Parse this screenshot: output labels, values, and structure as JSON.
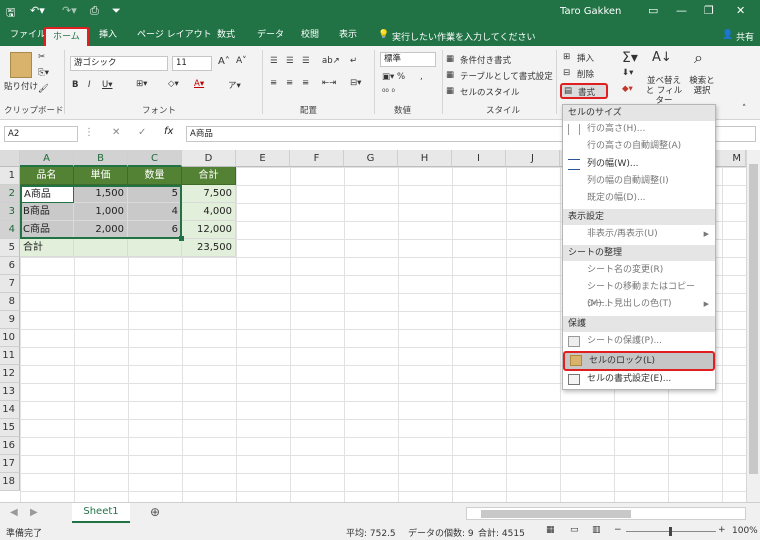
{
  "app": {
    "user": "Taro Gakken",
    "share": "共有"
  },
  "tabs": [
    "ファイル",
    "ホーム",
    "挿入",
    "ページ レイアウト",
    "数式",
    "データ",
    "校閲",
    "表示"
  ],
  "tell_me": "実行したい作業を入力してください",
  "ribbon": {
    "paste": "貼り付け",
    "font_name": "游ゴシック",
    "font_size": "11",
    "number_format": "標準",
    "cond_format": "条件付き書式",
    "table_format": "テーブルとして書式設定",
    "cell_style": "セルのスタイル",
    "insert": "挿入",
    "delete": "削除",
    "format": "書式",
    "sort_filter": "並べ替えと フィルター",
    "find_select": "検索と 選択",
    "groups": {
      "clipboard": "クリップボード",
      "font": "フォント",
      "alignment": "配置",
      "number": "数値",
      "style": "スタイル"
    }
  },
  "formula_bar": {
    "name_box": "A2",
    "content": "A商品"
  },
  "columns": [
    "A",
    "B",
    "C",
    "D",
    "E",
    "F",
    "G",
    "H",
    "I",
    "J",
    "K",
    "L",
    "M"
  ],
  "rows": [
    "1",
    "2",
    "3",
    "4",
    "5",
    "6",
    "7",
    "8",
    "9",
    "10",
    "11",
    "12",
    "13",
    "14",
    "15",
    "16",
    "17",
    "18"
  ],
  "table": {
    "headers": [
      "品名",
      "単価",
      "数量",
      "合計"
    ],
    "rows": [
      [
        "A商品",
        "1,500",
        "5",
        "7,500"
      ],
      [
        "B商品",
        "1,000",
        "4",
        "4,000"
      ],
      [
        "C商品",
        "2,000",
        "6",
        "12,000"
      ],
      [
        "合計",
        "",
        "",
        "23,500"
      ]
    ]
  },
  "format_menu": {
    "h_cell_size": "セルのサイズ",
    "row_height": "行の高さ(H)...",
    "row_autofit": "行の高さの自動調整(A)",
    "col_width": "列の幅(W)...",
    "col_autofit": "列の幅の自動調整(I)",
    "default_width": "既定の幅(D)...",
    "h_visibility": "表示設定",
    "hide_unhide": "非表示/再表示(U)",
    "h_organize": "シートの整理",
    "rename": "シート名の変更(R)",
    "move_copy": "シートの移動またはコピー(M)...",
    "tab_color": "シート見出しの色(T)",
    "h_protection": "保護",
    "protect_sheet": "シートの保護(P)...",
    "lock_cell": "セルのロック(L)",
    "format_cells": "セルの書式設定(E)..."
  },
  "sheet_tab": "Sheet1",
  "status": {
    "ready": "準備完了",
    "average": "平均: 752.5",
    "count": "データの個数: 9",
    "sum": "合計: 4515",
    "zoom": "100%"
  },
  "colors": {
    "excel_green": "#217346",
    "header_green": "#548235",
    "highlight_red": "#e02020"
  }
}
